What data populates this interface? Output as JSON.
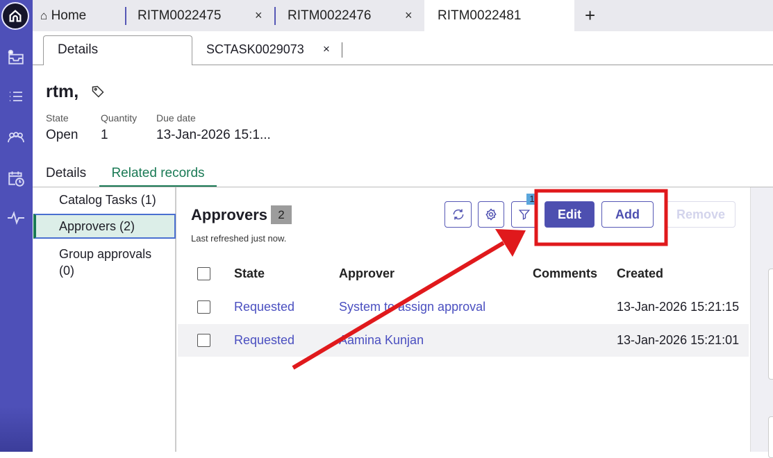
{
  "top_tabs": [
    {
      "label": "Home",
      "icon": "home-icon"
    },
    {
      "label": "RITM0022475",
      "close": "×"
    },
    {
      "label": "RITM0022476",
      "close": "×"
    },
    {
      "label": "RITM0022481"
    }
  ],
  "new_tab": "+",
  "sub_tabs": [
    {
      "label": "Details"
    },
    {
      "label": "SCTASK0029073",
      "close": "×"
    }
  ],
  "record": {
    "title": "rtm,",
    "fields": [
      {
        "label": "State",
        "value": "Open"
      },
      {
        "label": "Quantity",
        "value": "1"
      },
      {
        "label": "Due date",
        "value": "13-Jan-2026 15:1..."
      }
    ]
  },
  "record_tabs": [
    "Details",
    "Related records"
  ],
  "related_list": [
    "Catalog Tasks (1)",
    "Approvers (2)",
    "Group approvals (0)"
  ],
  "approvers": {
    "title": "Approvers",
    "count": "2",
    "refreshed": "Last refreshed just now.",
    "filter_count": "1",
    "buttons": {
      "edit": "Edit",
      "add": "Add",
      "remove": "Remove"
    },
    "columns": [
      "State",
      "Approver",
      "Comments",
      "Created"
    ],
    "rows": [
      {
        "state": "Requested",
        "approver": "System to assign approval",
        "comments": "",
        "created": "13-Jan-2026 15:21:15"
      },
      {
        "state": "Requested",
        "approver": "Aamina Kunjan",
        "comments": "",
        "created": "13-Jan-2026 15:21:01"
      }
    ]
  },
  "colors": {
    "sidebar": "#4e50b8",
    "primary": "#4d4fb0",
    "active_tab": "#1a7a55",
    "annotation": "#e0191c"
  }
}
